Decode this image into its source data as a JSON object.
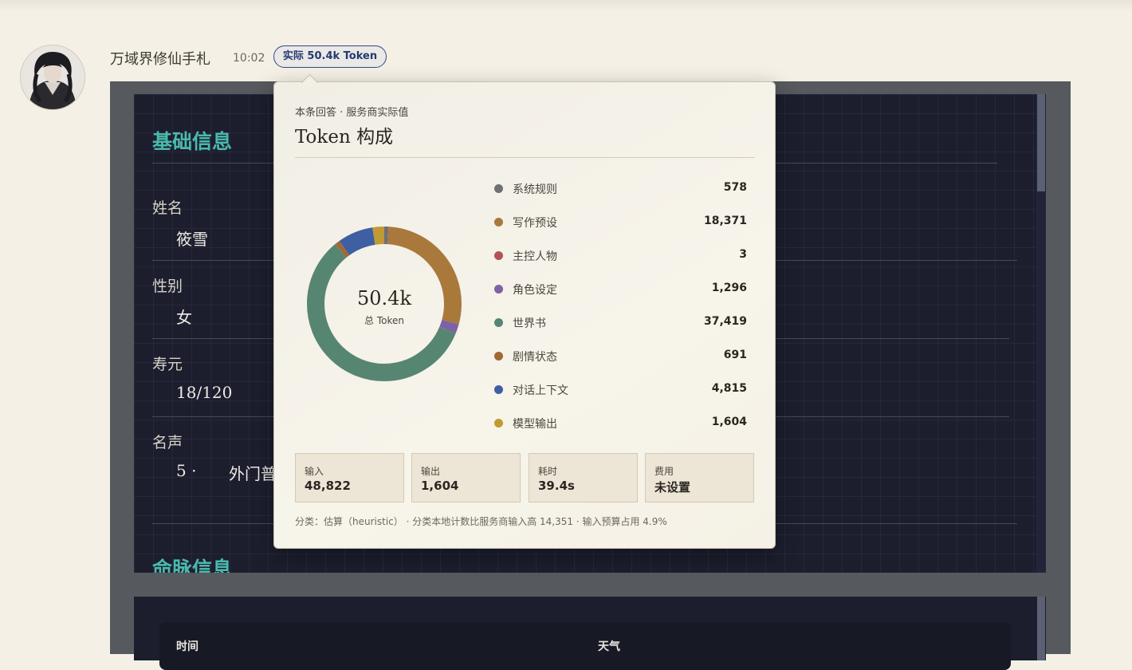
{
  "header": {
    "app_name": "万域界修仙手札",
    "time": "10:02",
    "token_pill": "实际 50.4k Token"
  },
  "card": {
    "section1_title": "基础信息",
    "fields": [
      {
        "label": "姓名",
        "value": "筱雪"
      },
      {
        "label": "性别",
        "value": "女"
      },
      {
        "label": "寿元",
        "value": "18/120"
      },
      {
        "label": "名声",
        "value": "5 ·",
        "value2": "外门普"
      }
    ],
    "section2_title": "命脉信息",
    "table_headers": [
      "时间",
      "天气"
    ]
  },
  "popover": {
    "subtitle": "本条回答 · 服务商实际值",
    "title": "Token 构成",
    "total": "50.4k",
    "total_label": "总 Token",
    "legend": [
      {
        "name": "系统规则",
        "display": "578"
      },
      {
        "name": "写作预设",
        "display": "18,371"
      },
      {
        "name": "主控人物",
        "display": "3"
      },
      {
        "name": "角色设定",
        "display": "1,296"
      },
      {
        "name": "世界书",
        "display": "37,419"
      },
      {
        "name": "剧情状态",
        "display": "691"
      },
      {
        "name": "对话上下文",
        "display": "4,815"
      },
      {
        "name": "模型输出",
        "display": "1,604"
      }
    ],
    "stats": [
      {
        "label": "输入",
        "value": "48,822"
      },
      {
        "label": "输出",
        "value": "1,604"
      },
      {
        "label": "耗时",
        "value": "39.4s"
      },
      {
        "label": "费用",
        "value": "未设置"
      }
    ],
    "footer": "分类：估算（heuristic） · 分类本地计数比服务商输入高 14,351 · 输入预算占用 4.9%"
  },
  "chart_data": {
    "type": "pie",
    "categories": [
      "系统规则",
      "写作预设",
      "主控人物",
      "角色设定",
      "世界书",
      "剧情状态",
      "对话上下文",
      "模型输出"
    ],
    "values": [
      578,
      18371,
      3,
      1296,
      37419,
      691,
      4815,
      1604
    ],
    "colors": [
      "#6f7073",
      "#a9793c",
      "#b0535a",
      "#7d63a3",
      "#568672",
      "#a06a30",
      "#3f5fa3",
      "#c09a32"
    ]
  }
}
